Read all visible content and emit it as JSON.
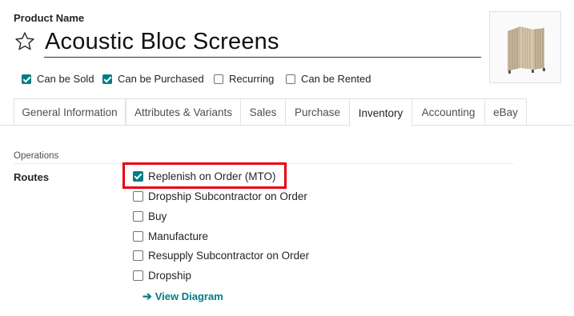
{
  "product": {
    "name_label": "Product Name",
    "name_value": "Acoustic Bloc Screens"
  },
  "options": [
    {
      "label": "Can be Sold",
      "checked": true
    },
    {
      "label": "Can be Purchased",
      "checked": true
    },
    {
      "label": "Recurring",
      "checked": false
    },
    {
      "label": "Can be Rented",
      "checked": false
    }
  ],
  "tabs": [
    {
      "label": "General Information",
      "active": false
    },
    {
      "label": "Attributes & Variants",
      "active": false
    },
    {
      "label": "Sales",
      "active": false
    },
    {
      "label": "Purchase",
      "active": false
    },
    {
      "label": "Inventory",
      "active": true
    },
    {
      "label": "Accounting",
      "active": false
    },
    {
      "label": "eBay",
      "active": false
    }
  ],
  "operations": {
    "section_title": "Operations",
    "routes_label": "Routes",
    "routes": [
      {
        "label": "Replenish on Order (MTO)",
        "checked": true
      },
      {
        "label": "Dropship Subcontractor on Order",
        "checked": false
      },
      {
        "label": "Buy",
        "checked": false
      },
      {
        "label": "Manufacture",
        "checked": false
      },
      {
        "label": "Resupply Subcontractor on Order",
        "checked": false
      },
      {
        "label": "Dropship",
        "checked": false
      }
    ],
    "view_diagram": "View Diagram"
  },
  "colors": {
    "accent": "#017e84",
    "highlight": "#e8000b"
  }
}
